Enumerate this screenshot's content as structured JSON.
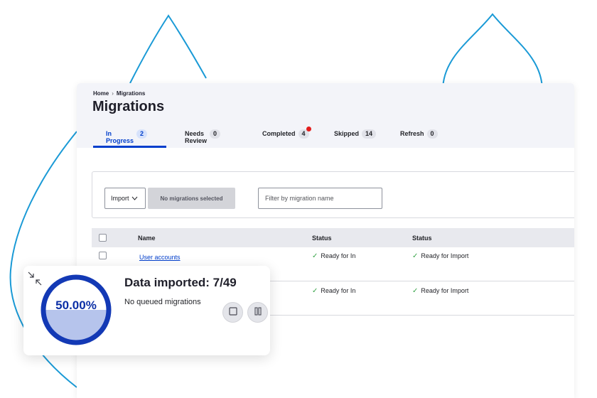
{
  "breadcrumb": {
    "home": "Home",
    "separator": "›",
    "current": "Migrations"
  },
  "page": {
    "title": "Migrations"
  },
  "tabs": [
    {
      "label": "In Progress",
      "count": "2",
      "active": true
    },
    {
      "label": "Needs Review",
      "count": "0"
    },
    {
      "label": "Completed",
      "count": "4",
      "has_alert_dot": true
    },
    {
      "label": "Skipped",
      "count": "14"
    },
    {
      "label": "Refresh",
      "count": "0"
    }
  ],
  "toolbar": {
    "action_select": "Import",
    "bulk_button": "No migrations selected",
    "filter_placeholder": "Filter by migration name"
  },
  "table": {
    "columns": [
      "Name",
      "Status",
      "Status"
    ],
    "rows": [
      {
        "name": "User accounts",
        "status_1": "Ready for In",
        "status_2": "Ready for Import"
      },
      {
        "name": "",
        "status_1": "Ready for In",
        "status_2": "Ready for Import"
      }
    ]
  },
  "widget": {
    "percent_label": "50.00%",
    "progress_fraction": 0.5,
    "title": "Data imported: 7/49",
    "subtitle": "No queued migrations"
  },
  "icons": {
    "status_ok": "check-icon",
    "select_chevron": "chevron-down-icon",
    "widget_collapse": "collapse-icon",
    "stop": "stop-icon",
    "pause": "pause-icon"
  },
  "colors": {
    "accent": "#003ecc",
    "success": "#3aa54b",
    "alert": "#e31d1d",
    "gauge_ring": "#1339b5",
    "gauge_fill": "#b6c4ec",
    "deco_line": "#1a9ad6"
  }
}
